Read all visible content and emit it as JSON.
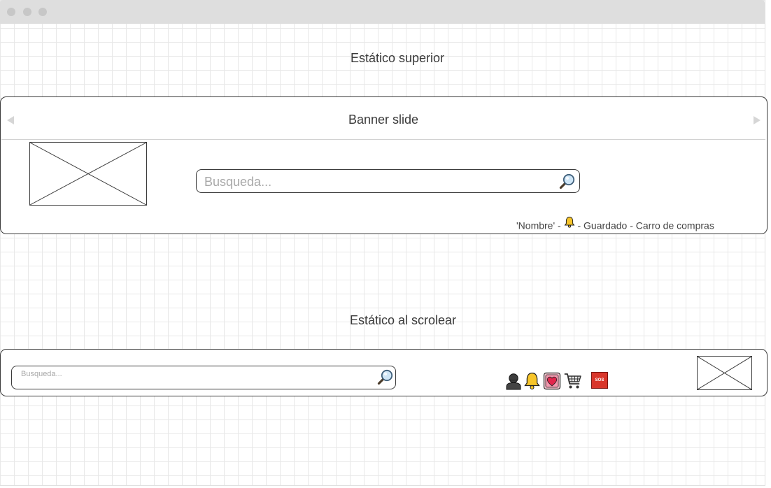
{
  "page": {
    "top_static_caption": "Estático superior",
    "scroll_static_caption": "Estático al scrolear"
  },
  "top_header": {
    "banner_label": "Banner slide",
    "search_placeholder": "Busqueda...",
    "user_links": {
      "name": "'Nombre'",
      "separator": "-",
      "saved": "Guardado",
      "cart": "Carro de compras"
    }
  },
  "sticky_header": {
    "search_placeholder": "Busqueda...",
    "sos_label": "SOS"
  },
  "icons": {
    "search": "magnifier-icon",
    "notifications": "bell-icon",
    "account": "user-icon",
    "saved": "heart-icon",
    "cart": "shopping-cart-icon",
    "help": "sos-icon",
    "banner_prev": "left-arrow-icon",
    "banner_next": "right-arrow-icon"
  },
  "colors": {
    "bell": "#f7c52a",
    "heart": "#e2264d",
    "sos": "#d9362b",
    "grid": "#e8e8e8",
    "outline": "#3a3a3a"
  }
}
